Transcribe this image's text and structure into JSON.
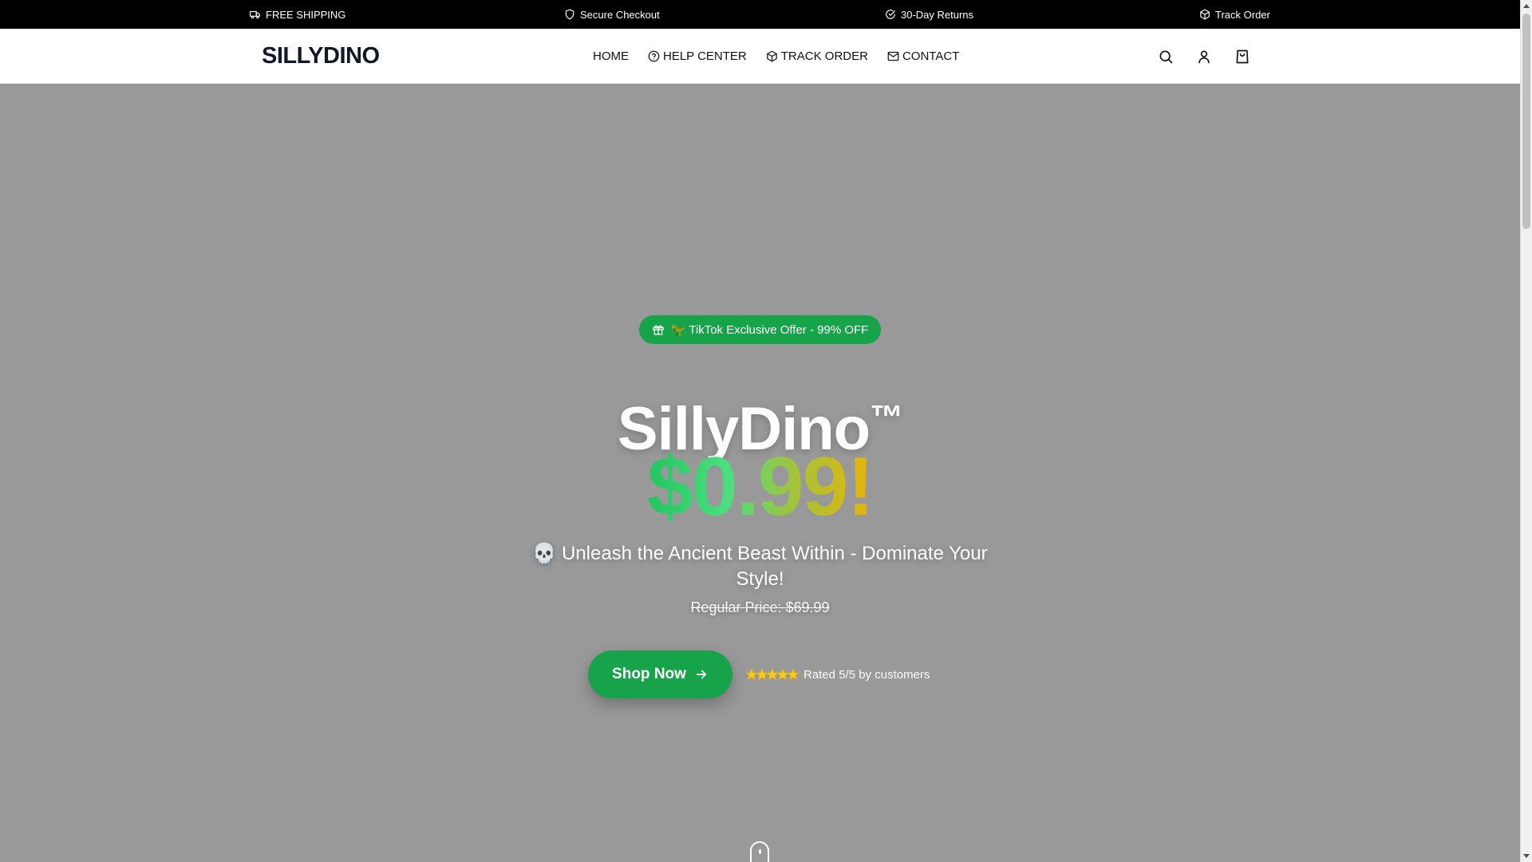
{
  "topbar": {
    "items": [
      {
        "label": "FREE SHIPPING",
        "icon": "truck-icon"
      },
      {
        "label": "Secure Checkout",
        "icon": "shield-icon"
      },
      {
        "label": "30-Day Returns",
        "icon": "check-circle-icon"
      },
      {
        "label": "Track Order",
        "icon": "package-icon"
      }
    ]
  },
  "header": {
    "logo": "SILLYDINO",
    "nav": [
      {
        "label": "HOME",
        "icon": ""
      },
      {
        "label": "HELP CENTER",
        "icon": "help-circle-icon"
      },
      {
        "label": "TRACK ORDER",
        "icon": "package-icon"
      },
      {
        "label": "CONTACT",
        "icon": "mail-icon"
      }
    ],
    "icons": [
      "search-icon",
      "user-icon",
      "shopping-bag-icon"
    ]
  },
  "hero": {
    "badge": "🦖 TikTok Exclusive Offer - 99% OFF",
    "badge_icon": "gift-icon",
    "title": "SillyDino",
    "title_mark": "™",
    "price": "$0.99!",
    "subtitle": "💀 Unleash the Ancient Beast Within - Dominate Your Style!",
    "regular_price": "Regular Price: $69.99",
    "cta_label": "Shop Now",
    "rating_text": "Rated 5/5 by customers",
    "rating_value": 5,
    "rating_max": 5
  },
  "colors": {
    "accent": "#16a34a",
    "hero_bg": "#999999",
    "topbar_bg": "#000000",
    "star": "#facc15"
  }
}
